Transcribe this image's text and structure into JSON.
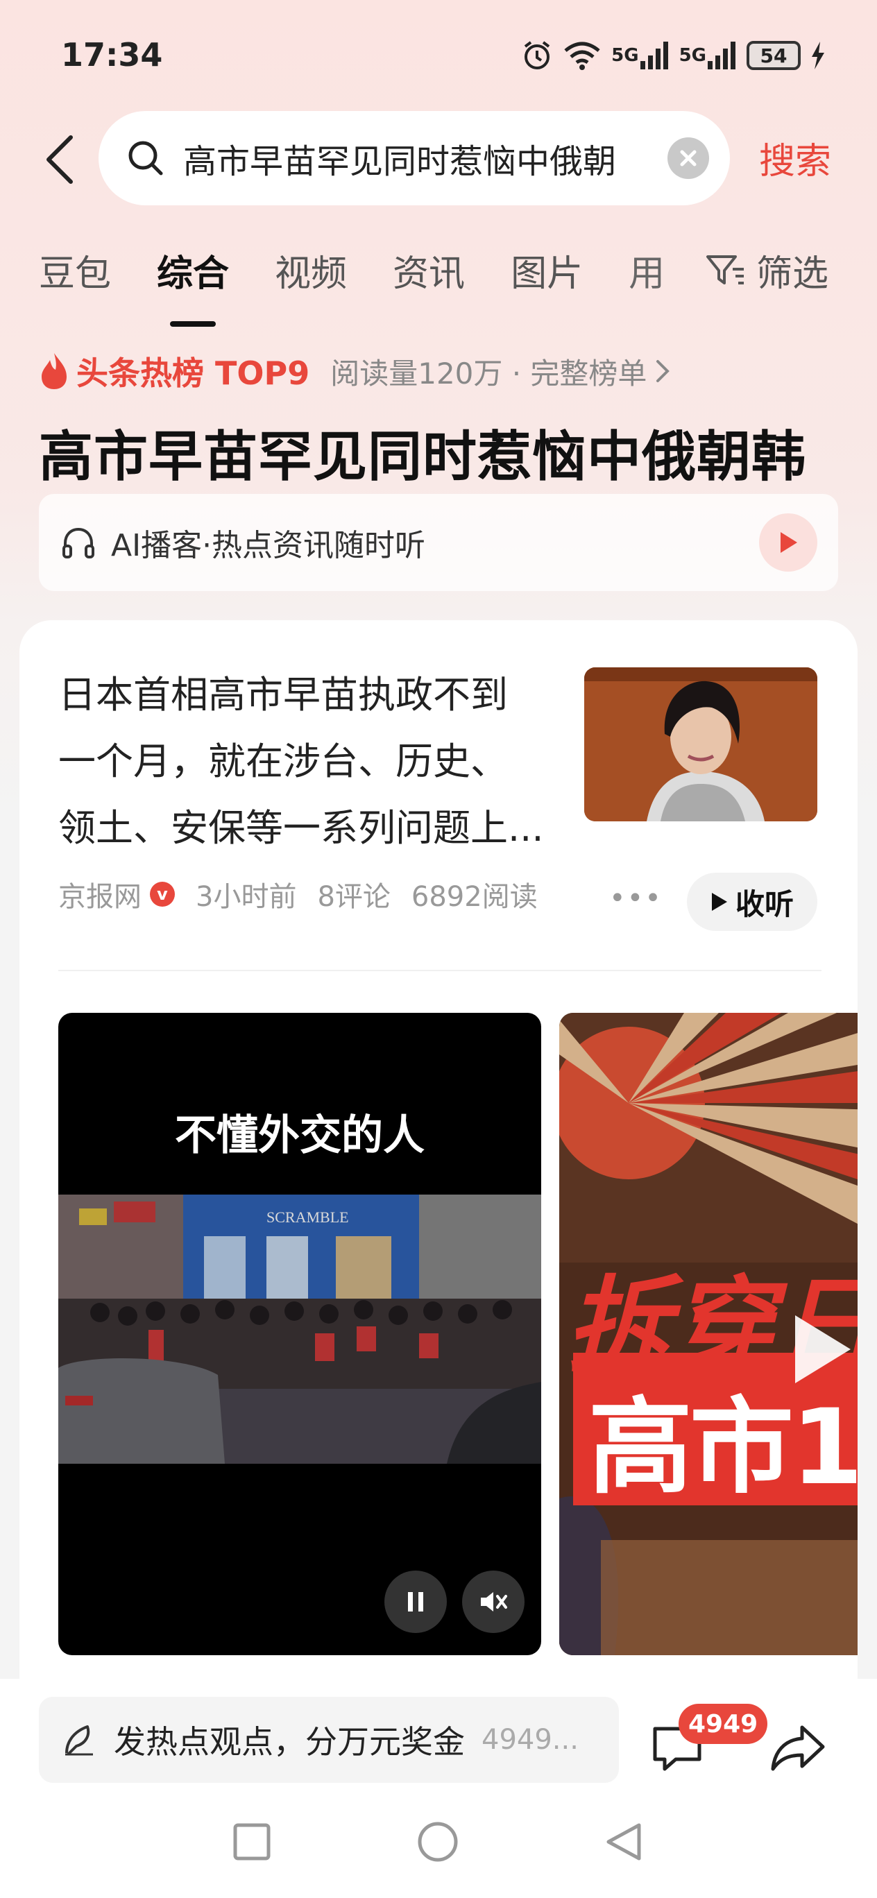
{
  "status_bar": {
    "time": "17:34",
    "network_1": "5G",
    "network_2": "5G",
    "battery": "54",
    "icons": [
      "alarm-icon",
      "wifi-icon",
      "signal-icon",
      "signal-icon",
      "battery-icon",
      "charging-icon"
    ]
  },
  "search": {
    "query": "高市早苗罕见同时惹恼中俄朝",
    "button_label": "搜索"
  },
  "tabs": [
    "豆包",
    "综合",
    "视频",
    "资讯",
    "图片",
    "用"
  ],
  "active_tab": "综合",
  "filter_label": "筛选",
  "hot_rank": {
    "label": "头条热榜 TOP9",
    "meta": "阅读量120万 · 完整榜单",
    "headline": "高市早苗罕见同时惹恼中俄朝韩"
  },
  "podcast": {
    "label": "AI播客·热点资讯随时听"
  },
  "article": {
    "text_lines": [
      "日本首相高市早苗执政不到",
      "一个月，就在涉台、历史、",
      "领土、安保等一系列问题上..."
    ],
    "source": "京报网",
    "verified_badge": "v",
    "time": "3小时前",
    "comments": "8评论",
    "reads": "6892阅读",
    "listen_label": "收听"
  },
  "videos": [
    {
      "caption": "不懂外交的人",
      "sign_text": "SCRAMBLE"
    },
    {
      "top_text": "拆穿日",
      "big_text": "高市1"
    }
  ],
  "bottom_bar": {
    "comment_prompt": "发热点观点，分万元奖金",
    "comment_count_preview": "4949...",
    "badge_count": "4949"
  },
  "colors": {
    "accent": "#e8473c",
    "card_bg": "#ffffff",
    "video_bg": "#000000"
  }
}
